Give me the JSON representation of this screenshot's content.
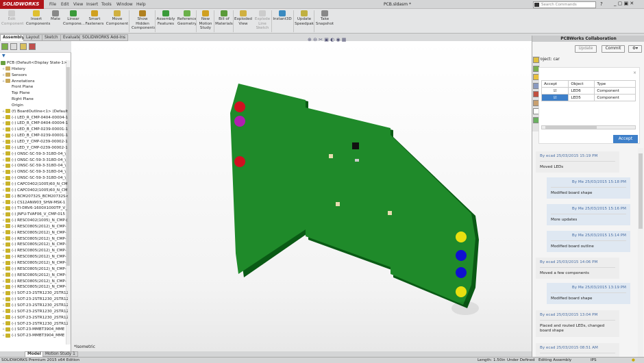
{
  "app": {
    "logo": "SOLIDWORKS",
    "doc_title": "PCB.sldasm *",
    "search_placeholder": "Search Commands"
  },
  "menu": [
    "File",
    "Edit",
    "View",
    "Insert",
    "Tools",
    "Window",
    "Help"
  ],
  "toolbar": [
    {
      "label": "Edit Component",
      "disabled": true
    },
    {
      "label": "Insert Components"
    },
    {
      "label": "Mate"
    },
    {
      "label": "Linear Compone..."
    },
    {
      "label": "Smart Fasteners"
    },
    {
      "label": "Move Component"
    },
    {
      "label": "Show Hidden Components"
    },
    {
      "label": "Assembly Features"
    },
    {
      "label": "Reference Geometry"
    },
    {
      "label": "New Motion Study"
    },
    {
      "label": "Bill of Materials"
    },
    {
      "label": "Exploded View"
    },
    {
      "label": "Explode Line Sketch",
      "disabled": true
    },
    {
      "label": "Instant3D"
    },
    {
      "label": "Update Speedpak"
    },
    {
      "label": "Take Snapshot"
    }
  ],
  "tabs": [
    "Assembly",
    "Layout",
    "Sketch",
    "Evaluate",
    "SOLIDWORKS Add-Ins"
  ],
  "tree": {
    "root": "PCB  (Default<Display State-1>)",
    "items": [
      "History",
      "Sensors",
      "Annotations",
      "Front Plane",
      "Top Plane",
      "Right Plane",
      "Origin",
      "(f) BoardOutline<1> (Default",
      "(-) LED_R_CMP-0404-00004-1",
      "(-) LED_R_CMP-0404-00004-1",
      "(-) LED_B_CMP-0239-00001-1",
      "(-) LED_B_CMP-0239-00001-1",
      "(-) LED_Y_CMP-0239-00002-1",
      "(-) LED_Y_CMP-0239-00002-1",
      "(-) ONSC-SC-59-3-318D-04_\\",
      "(-) ONSC-SC-59-3-318D-04_\\",
      "(-) ONSC-SC-59-3-318D-04_\\",
      "(-) ONSC-SC-59-3-318D-04_\\",
      "(-) ONSC-SC-59-3-318D-04_\\",
      "(-) CAPC0402(1005)60_N_CM",
      "(-) CAPC0402(1005)60_N_CM",
      "(-) BCM20732S_BCM20732S<",
      "(-) CS12ANW03_SHW-MSK-1",
      "(-) TI-DRV6-1600X1000TP_V_",
      "(-) JNFU-TVAF06_V_CMP-015",
      "(-) RESC0402(1005)_N_CMP-(",
      "(-) RESC0805(2012)_N_CMP-",
      "(-) RESC0805(2012)_N_CMP-",
      "(-) RESC0805(2012)_N_CMP-",
      "(-) RESC0805(2012)_N_CMP-",
      "(-) RESC0805(2012)_N_CMP-",
      "(-) RESC0805(2012)_N_CMP-",
      "(-) RESC0805(2012)_N_CMP-",
      "(-) RESC0805(2012)_N_CMP-",
      "(-) RESC0805(2012)_N_CMP-",
      "(-) RESC0805(2012)_N_CMP-",
      "(-) RESC0805(2012)_N_CMP-",
      "(-) SOT-23-2STR1230_2STR12",
      "(-) SOT-23-2STR1230_2STR12",
      "(-) SOT-23-2STR1230_2STR12",
      "(-) SOT-23-2STR1230_2STR12",
      "(-) SOT-23-2STR1230_2STR12",
      "(-) SOT-23-2STR1230_2STR12",
      "(-) SOT-23-MMBT3904_MME",
      "(-) SOT-23-MMBT3904_MME"
    ]
  },
  "bottom_tabs": [
    "Model",
    "Motion Study 1"
  ],
  "viewport": {
    "view_label": "*Isometric",
    "board_color": "#1f8a2a"
  },
  "panel": {
    "title": "PCBWorks Collaboration",
    "update": "Update",
    "commit": "Commit",
    "project": "Project: car",
    "table": {
      "headers": [
        "Accept",
        "Object",
        "Type"
      ],
      "rows": [
        {
          "accept": true,
          "object": "LED6",
          "type": "Component",
          "selected": false
        },
        {
          "accept": true,
          "object": "LED5",
          "type": "Component",
          "selected": true
        }
      ]
    },
    "accept_button": "Accept",
    "messages": [
      {
        "from": "them",
        "by": "By ecad",
        "time": "25/03/2015 15:19 PM",
        "text": "Moved LEDs"
      },
      {
        "from": "me",
        "by": "By Me",
        "time": "25/03/2015 15:18 PM",
        "text": "Modified board shape"
      },
      {
        "from": "me",
        "by": "By Me",
        "time": "25/03/2015 15:16 PM",
        "text": "More updates"
      },
      {
        "from": "me",
        "by": "By Me",
        "time": "25/03/2015 15:14 PM",
        "text": "Modified board outline"
      },
      {
        "from": "them",
        "by": "By ecad",
        "time": "25/03/2015 14:06 PM",
        "text": "Moved a few components"
      },
      {
        "from": "me",
        "by": "By Me",
        "time": "25/03/2015 13:19 PM",
        "text": "Modified board shape"
      },
      {
        "from": "them",
        "by": "By ecad",
        "time": "25/03/2015 13:04 PM",
        "text": "Placed and routed LEDs, changed board shape"
      },
      {
        "from": "them",
        "by": "By ecad",
        "time": "25/03/2015 08:51 AM",
        "text": ""
      }
    ]
  },
  "status": {
    "edition": "SOLIDWORKS Premium 2015 x64 Edition",
    "length": "Length: 1.50in",
    "defined": "Under Defined",
    "mode": "Editing Assembly",
    "units": "IPS"
  },
  "colors": {
    "accent": "#3d7fc9",
    "brand": "#b0151a"
  }
}
